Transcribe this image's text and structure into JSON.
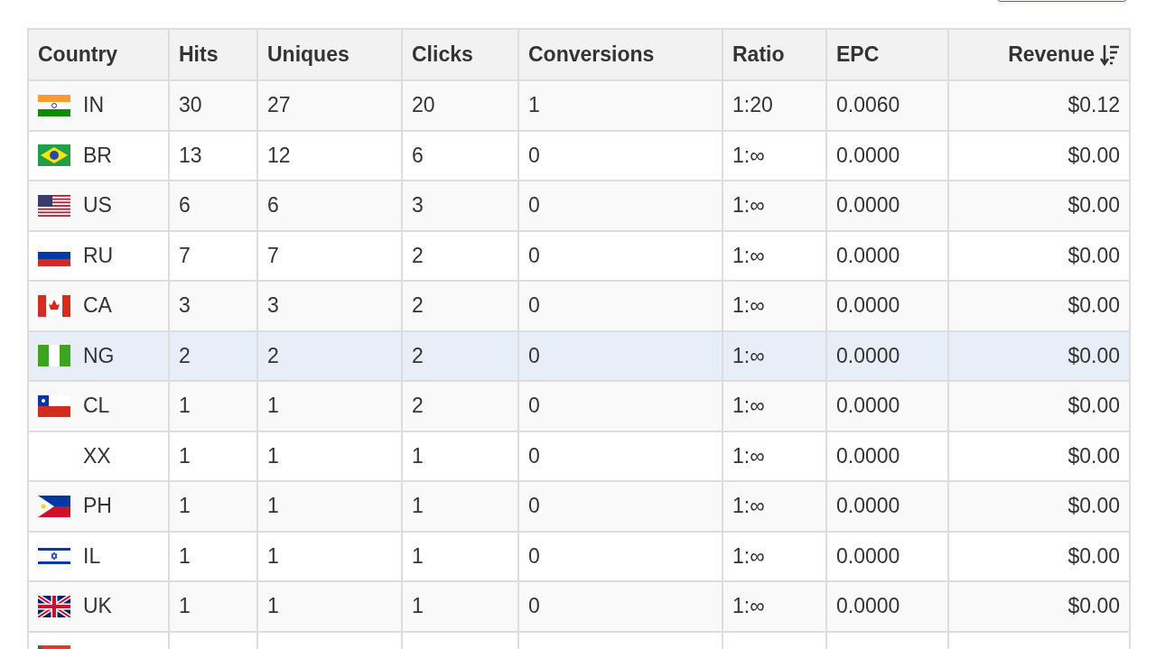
{
  "table": {
    "columns": [
      {
        "label": "Country",
        "sorted": false
      },
      {
        "label": "Hits",
        "sorted": false
      },
      {
        "label": "Uniques",
        "sorted": false
      },
      {
        "label": "Clicks",
        "sorted": false
      },
      {
        "label": "Conversions",
        "sorted": false
      },
      {
        "label": "Ratio",
        "sorted": false
      },
      {
        "label": "EPC",
        "sorted": false
      },
      {
        "label": "Revenue",
        "sorted": true
      }
    ],
    "rows": [
      {
        "kind": "in",
        "cells": [
          "IN",
          "30",
          "27",
          "20",
          "1",
          "1:20",
          "0.0060",
          "$0.12"
        ],
        "selected": false
      },
      {
        "kind": "br",
        "cells": [
          "BR",
          "13",
          "12",
          "6",
          "0",
          "1:∞",
          "0.0000",
          "$0.00"
        ],
        "selected": false
      },
      {
        "kind": "us",
        "cells": [
          "US",
          "6",
          "6",
          "3",
          "0",
          "1:∞",
          "0.0000",
          "$0.00"
        ],
        "selected": false
      },
      {
        "kind": "ru",
        "cells": [
          "RU",
          "7",
          "7",
          "2",
          "0",
          "1:∞",
          "0.0000",
          "$0.00"
        ],
        "selected": false
      },
      {
        "kind": "ca",
        "cells": [
          "CA",
          "3",
          "3",
          "2",
          "0",
          "1:∞",
          "0.0000",
          "$0.00"
        ],
        "selected": false
      },
      {
        "kind": "ng",
        "cells": [
          "NG",
          "2",
          "2",
          "2",
          "0",
          "1:∞",
          "0.0000",
          "$0.00"
        ],
        "selected": true
      },
      {
        "kind": "cl",
        "cells": [
          "CL",
          "1",
          "1",
          "2",
          "0",
          "1:∞",
          "0.0000",
          "$0.00"
        ],
        "selected": false
      },
      {
        "kind": "none",
        "cells": [
          "XX",
          "1",
          "1",
          "1",
          "0",
          "1:∞",
          "0.0000",
          "$0.00"
        ],
        "selected": false
      },
      {
        "kind": "ph",
        "cells": [
          "PH",
          "1",
          "1",
          "1",
          "0",
          "1:∞",
          "0.0000",
          "$0.00"
        ],
        "selected": false
      },
      {
        "kind": "il",
        "cells": [
          "IL",
          "1",
          "1",
          "1",
          "0",
          "1:∞",
          "0.0000",
          "$0.00"
        ],
        "selected": false
      },
      {
        "kind": "uk",
        "cells": [
          "UK",
          "1",
          "1",
          "1",
          "0",
          "1:∞",
          "0.0000",
          "$0.00"
        ],
        "selected": false
      },
      {
        "kind": "za",
        "cells": [],
        "selected": false
      }
    ]
  }
}
